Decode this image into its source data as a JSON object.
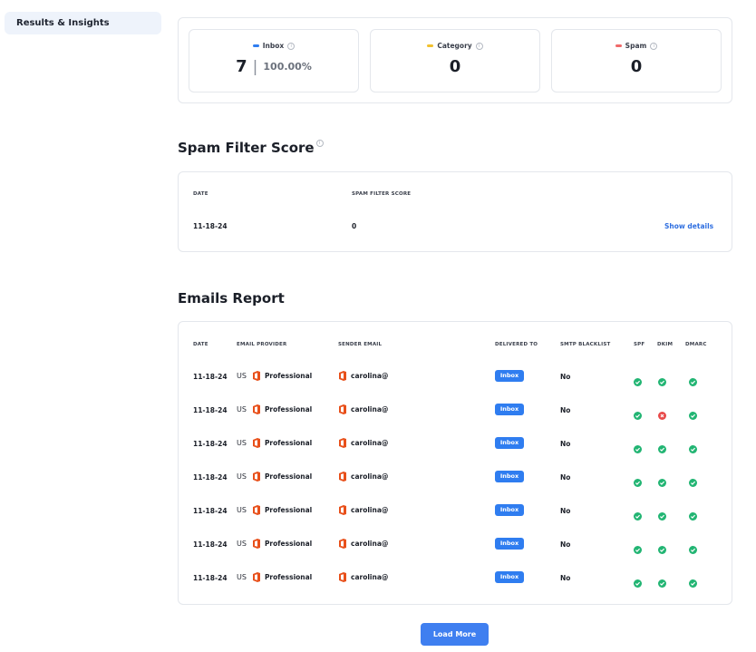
{
  "sidebar": {
    "active_item": "Results & Insights"
  },
  "stats": [
    {
      "label": "Inbox",
      "color": "#2f7df0",
      "value": "7",
      "percent": "100.00%"
    },
    {
      "label": "Category",
      "color": "#f2c12e",
      "value": "0"
    },
    {
      "label": "Spam",
      "color": "#f06a6a",
      "value": "0"
    }
  ],
  "spam_filter": {
    "title": "Spam Filter Score",
    "headers": {
      "date": "DATE",
      "score": "SPAM FILTER SCORE"
    },
    "row": {
      "date": "11-18-24",
      "score": "0",
      "action": "Show details"
    }
  },
  "emails_report": {
    "title": "Emails Report",
    "headers": {
      "date": "DATE",
      "provider": "EMAIL PROVIDER",
      "sender": "SENDER EMAIL",
      "delivered": "DELIVERED TO",
      "blacklist": "SMTP BLACKLIST",
      "spf": "SPF",
      "dkim": "DKIM",
      "dmarc": "DMARC"
    },
    "rows": [
      {
        "date": "11-18-24",
        "country": "US",
        "provider": "Professional",
        "sender": "carolina@",
        "delivered": "Inbox",
        "blacklist": "No",
        "spf": "pass",
        "dkim": "pass",
        "dmarc": "pass"
      },
      {
        "date": "11-18-24",
        "country": "US",
        "provider": "Professional",
        "sender": "carolina@",
        "delivered": "Inbox",
        "blacklist": "No",
        "spf": "pass",
        "dkim": "fail",
        "dmarc": "pass"
      },
      {
        "date": "11-18-24",
        "country": "US",
        "provider": "Professional",
        "sender": "carolina@",
        "delivered": "Inbox",
        "blacklist": "No",
        "spf": "pass",
        "dkim": "pass",
        "dmarc": "pass"
      },
      {
        "date": "11-18-24",
        "country": "US",
        "provider": "Professional",
        "sender": "carolina@",
        "delivered": "Inbox",
        "blacklist": "No",
        "spf": "pass",
        "dkim": "pass",
        "dmarc": "pass"
      },
      {
        "date": "11-18-24",
        "country": "US",
        "provider": "Professional",
        "sender": "carolina@",
        "delivered": "Inbox",
        "blacklist": "No",
        "spf": "pass",
        "dkim": "pass",
        "dmarc": "pass"
      },
      {
        "date": "11-18-24",
        "country": "US",
        "provider": "Professional",
        "sender": "carolina@",
        "delivered": "Inbox",
        "blacklist": "No",
        "spf": "pass",
        "dkim": "pass",
        "dmarc": "pass"
      },
      {
        "date": "11-18-24",
        "country": "US",
        "provider": "Professional",
        "sender": "carolina@",
        "delivered": "Inbox",
        "blacklist": "No",
        "spf": "pass",
        "dkim": "pass",
        "dmarc": "pass"
      }
    ]
  },
  "load_more_label": "Load More",
  "colors": {
    "pass": "#22b573",
    "fail": "#e84a4a",
    "brand": "#2f7df0",
    "office": "#e8501b"
  },
  "icons": {
    "provider": "office-icon",
    "info": "info-icon",
    "status_pass": "check-icon",
    "status_fail": "x-icon"
  }
}
